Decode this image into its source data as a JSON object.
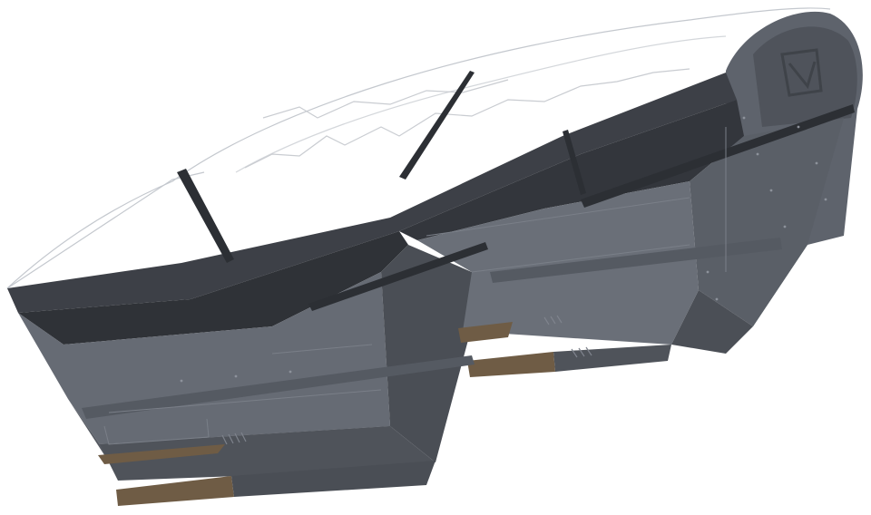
{
  "image": {
    "subject": "cockpit-section-render",
    "colors": {
      "background": "#ffffff",
      "panel_light": "#6b707a",
      "panel_mid": "#565b64",
      "panel_dark": "#3c3f46",
      "panel_darker": "#2b2e33",
      "rail": "#2f3237",
      "rivet": "#8d929b",
      "floor_pad": "#6f5c45",
      "canopy_line": "#b8bcc2"
    }
  }
}
